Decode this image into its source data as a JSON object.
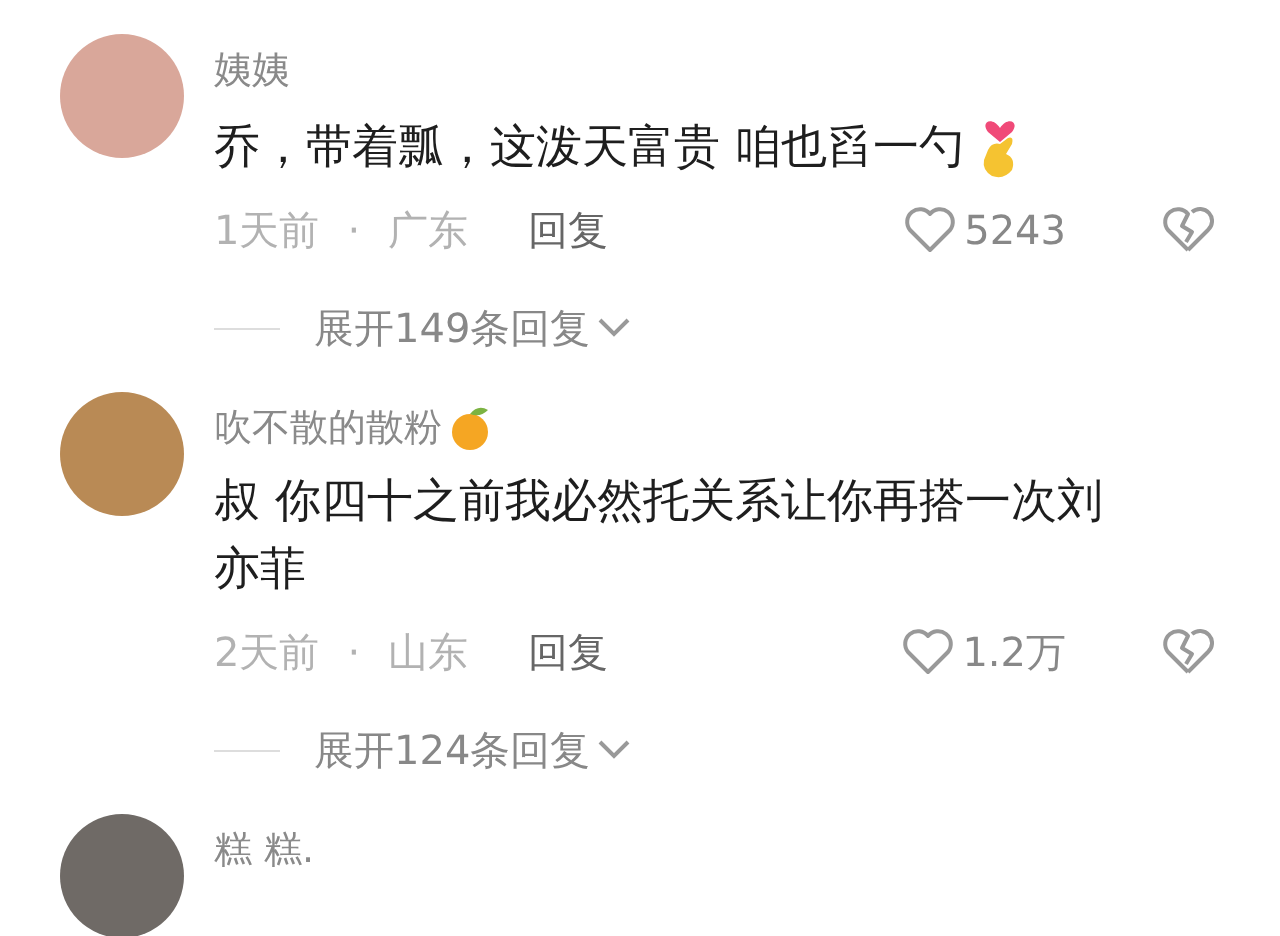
{
  "comments": [
    {
      "author": "姨姨",
      "text": "乔，带着瓢，这泼天富贵 咱也舀一勺",
      "text_icons": [
        {
          "kind": "finger-heart"
        }
      ],
      "time": "1天前",
      "separator": "·",
      "location": "广东",
      "reply": "回复",
      "likes": "5243",
      "expand": "展开149条回复"
    },
    {
      "author": "吹不散的散粉",
      "author_icons": [
        {
          "kind": "tangerine"
        }
      ],
      "text": "叔 你四十之前我必然托关系让你再搭一次刘亦菲",
      "time": "2天前",
      "separator": "·",
      "location": "山东",
      "reply": "回复",
      "likes": "1.2万",
      "expand": "展开124条回复"
    },
    {
      "author": "糕 糕."
    }
  ]
}
